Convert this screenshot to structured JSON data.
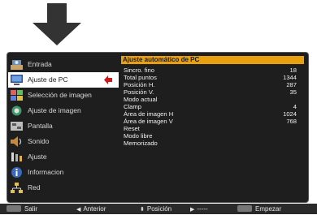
{
  "sidebar": {
    "items": [
      {
        "label": "Entrada",
        "icon": "input-icon"
      },
      {
        "label": "Ajuste de PC",
        "icon": "pc-adjust-icon"
      },
      {
        "label": "Selección de imagen",
        "icon": "image-select-icon"
      },
      {
        "label": "Ajuste de imagen",
        "icon": "image-adjust-icon"
      },
      {
        "label": "Pantalla",
        "icon": "screen-icon"
      },
      {
        "label": "Sonido",
        "icon": "sound-icon"
      },
      {
        "label": "Ajuste",
        "icon": "settings-icon"
      },
      {
        "label": "Informacion",
        "icon": "info-icon"
      },
      {
        "label": "Red",
        "icon": "network-icon"
      }
    ],
    "active_index": 1
  },
  "panel": {
    "title": "Ajuste automático de PC",
    "rows": [
      {
        "label": "Sincro. fino",
        "value": "18"
      },
      {
        "label": "Total puntos",
        "value": "1344"
      },
      {
        "label": "Posición H.",
        "value": "287"
      },
      {
        "label": "Posición V.",
        "value": "35"
      },
      {
        "label": "Modo actual",
        "value": ""
      },
      {
        "label": "Clamp",
        "value": "4"
      },
      {
        "label": "Área de imagen H",
        "value": "1024"
      },
      {
        "label": "Área de imagen V",
        "value": "768"
      },
      {
        "label": "Reset",
        "value": ""
      },
      {
        "label": "Modo libre",
        "value": ""
      },
      {
        "label": "Memorizado",
        "value": ""
      }
    ]
  },
  "statusbar": {
    "salir": "Salir",
    "anterior": "Anterior",
    "posicion": "Posición",
    "dash": "-----",
    "empezar": "Empezar"
  },
  "colors": {
    "accent": "#e8a010",
    "active_bg": "#ffffff",
    "osd_bg": "#1e1e1e"
  }
}
